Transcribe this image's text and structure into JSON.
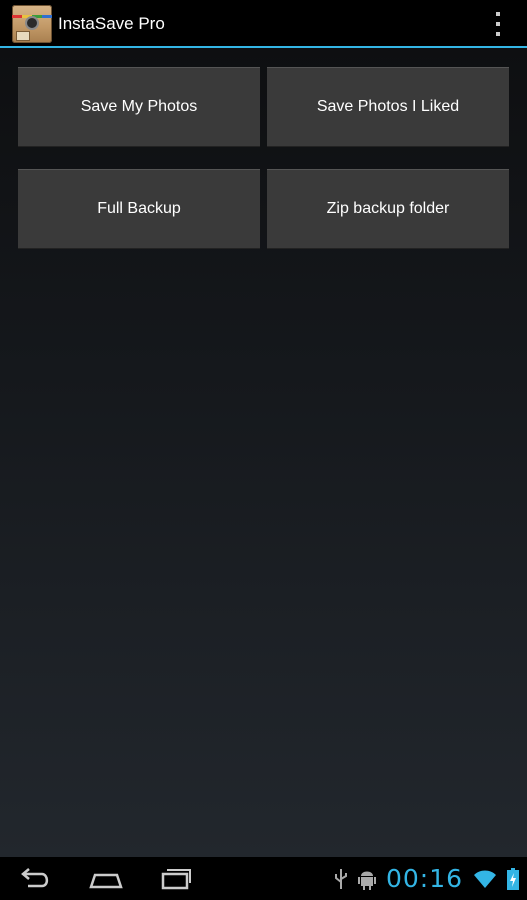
{
  "app": {
    "title": "InstaSave Pro",
    "icon": "instasave-app-icon",
    "accent_color": "#33b5e5"
  },
  "actions": {
    "overflow_icon": "overflow-menu-icon"
  },
  "buttons": [
    {
      "label": "Save My Photos"
    },
    {
      "label": "Save Photos I Liked"
    },
    {
      "label": "Full Backup"
    },
    {
      "label": "Zip backup folder"
    }
  ],
  "system_bar": {
    "nav_icons": [
      "back-icon",
      "home-icon",
      "recent-apps-icon"
    ],
    "notification_icons": [
      "usb-icon",
      "android-debug-icon"
    ],
    "clock": "00:16",
    "status_icons": [
      "wifi-icon",
      "battery-charging-icon"
    ]
  }
}
